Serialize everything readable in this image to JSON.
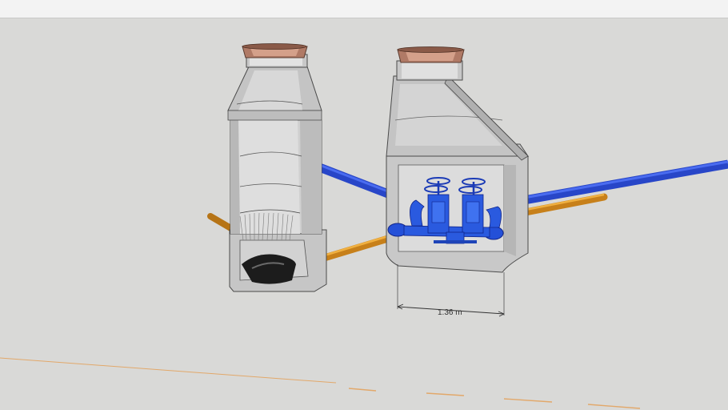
{
  "viewport": {
    "background": "#d9d9d7",
    "dimension": {
      "label": "1.36 m"
    }
  },
  "colors": {
    "concrete": "#c9c9c9",
    "concrete_dark": "#a9a9a9",
    "edge": "#4a4a4a",
    "water_pipe": "#2d4fd1",
    "sewer_pipe": "#d4902a",
    "valve": "#2a5adf",
    "lid": "#b87e6a",
    "axis_line": "#e0a060"
  },
  "icons": {
    "valve_handwheel": "valve-handwheel-icon"
  }
}
